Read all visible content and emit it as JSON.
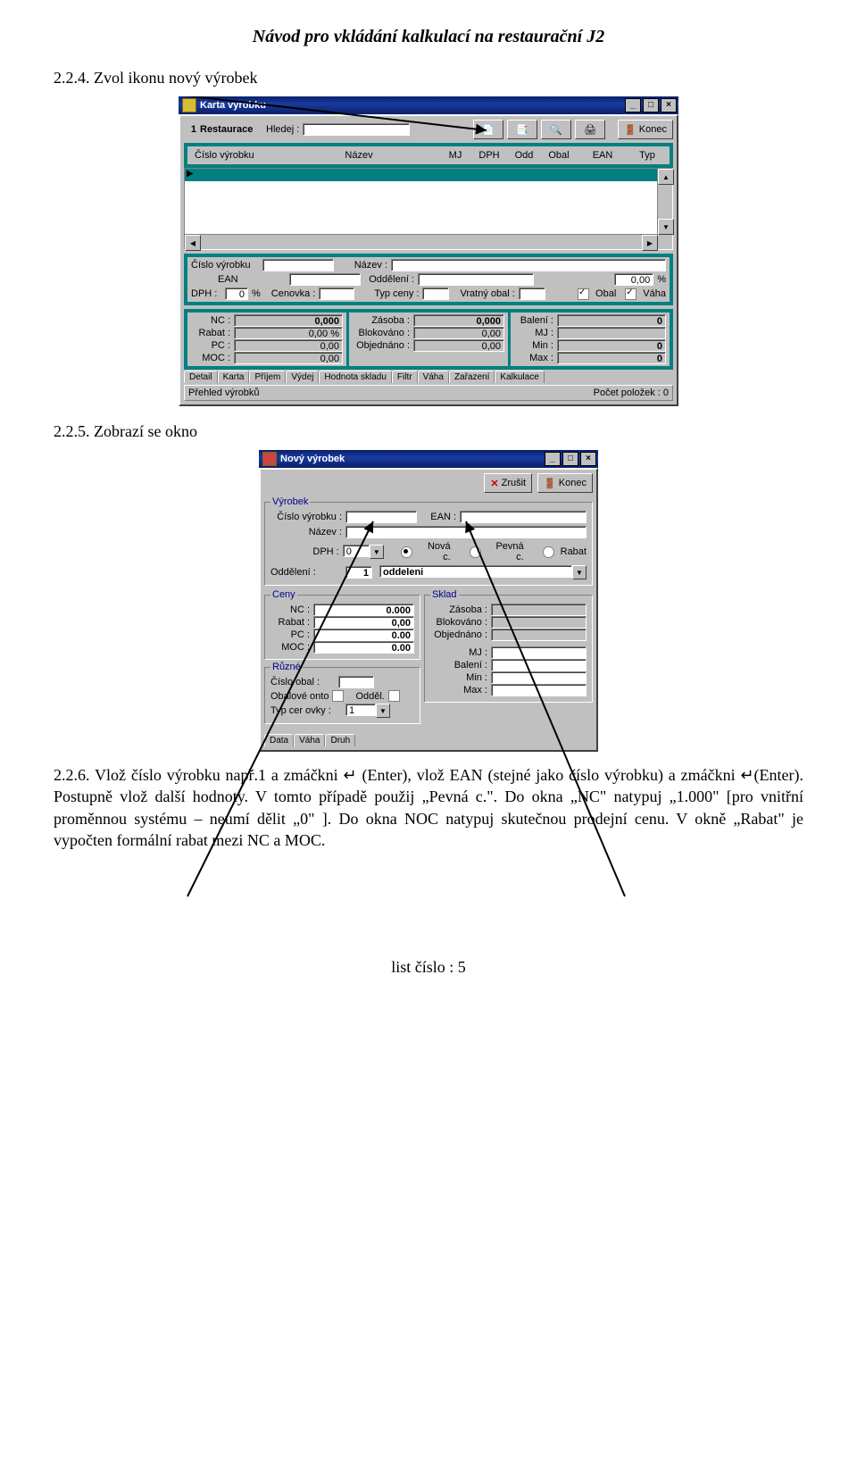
{
  "doc": {
    "title": "Návod pro vkládání kalkulací na restaurační J2",
    "step224": "2.2.4. Zvol ikonu nový výrobek",
    "step225": "2.2.5. Zobrazí se okno",
    "para": "2.2.6. Vlož číslo výrobku např.1 a zmáčkni   ↵ (Enter), vlož EAN (stejné jako číslo výrobku) a zmáčkni  ↵(Enter). Postupně vlož další hodnoty. V tomto případě použij „Pevná c.\". Do okna „NC\" natypuj „1.000\" [pro vnitřní proměnnou systému – neumí dělit „0\" ]. Do okna NOC natypuj skutečnou prodejní cenu. V okně „Rabat\" je vypočten formální rabat mezi NC a MOC.",
    "footer": "list číslo :  5"
  },
  "winA": {
    "title": "Karta výrobku",
    "id_label": "1",
    "restaurant": "Restaurace",
    "search_label": "Hledej :",
    "konec": "Konec",
    "cols": {
      "cislo": "Číslo výrobku",
      "nazev": "Název",
      "mj": "MJ",
      "dph": "DPH",
      "odd": "Odd",
      "obal": "Obal",
      "ean": "EAN",
      "typ": "Typ"
    },
    "f": {
      "cislo_vyrobku": "Číslo výrobku",
      "nazev": "Název :",
      "ean": "EAN",
      "oddeleni": "Oddělení :",
      "dph": "DPH :",
      "dph_val": "0",
      "dph_pct": "%",
      "cenovka": "Cenovka :",
      "typceny": "Typ ceny :",
      "vratny": "Vratný obal :",
      "obal_chk": "Obal",
      "vaha_chk": "Váha",
      "pct000": "0,00",
      "pctlbl": "%"
    },
    "g1": {
      "nc": "NC :",
      "rabat": "Rabat :",
      "pc": "PC :",
      "moc": "MOC :",
      "v1": "0,000",
      "v2": "0,00 %",
      "v3": "0,00",
      "v4": "0,00"
    },
    "g2": {
      "zasoba": "Zásoba :",
      "blok": "Blokováno :",
      "obj": "Objednáno :",
      "v1": "0,000",
      "v2": "0,00",
      "v3": "0,00"
    },
    "g3": {
      "baleni": "Balení :",
      "mj": "MJ :",
      "min": "Min :",
      "max": "Max :",
      "v1": "0",
      "v2": "",
      "v3": "0",
      "v4": "0"
    },
    "tabs": [
      "Detail",
      "Karta",
      "Příjem",
      "Výdej",
      "Hodnota skladu",
      "Filtr",
      "Váha",
      "Zařazení",
      "Kalkulace"
    ],
    "status_left": "Přehled výrobků",
    "status_right": "Počet položek : 0"
  },
  "winB": {
    "title": "Nový výrobek",
    "zrusit": "Zrušit",
    "konec": "Konec",
    "grp_vyrobek": "Výrobek",
    "cislo": "Číslo výrobku :",
    "ean": "EAN :",
    "nazev": "Název :",
    "dph": "DPH :",
    "dph_val": "0",
    "r_nova": "Nová c.",
    "r_pevna": "Pevná c.",
    "r_rabat": "Rabat",
    "oddeleni_lbl": "Oddělení :",
    "oddeleni_id": "1",
    "oddeleni_txt": "oddeleni",
    "grp_ceny": "Ceny",
    "ceny": {
      "nc": "NC :",
      "rabat": "Rabat :",
      "pc": "PC :",
      "moc": "MOC :",
      "v1": "0.000",
      "v2": "0,00",
      "v3": "0.00",
      "v4": "0.00"
    },
    "grp_sklad": "Sklad",
    "sklad": {
      "zasoba": "Zásoba :",
      "blok": "Blokováno :",
      "obj": "Objednáno :",
      "mj": "MJ :",
      "baleni": "Balení :",
      "min": "Min :",
      "max": "Max :"
    },
    "grp_ruzne": "Různé",
    "cislo_obal": "Číslo obal    :",
    "obalove_onto": "Obalové   onto",
    "oddel": "Odděl.",
    "typ_cerovky": "Typ cer ovky  :",
    "typ_cerovky_val": "1",
    "tabs": [
      "Data",
      "Váha",
      "Druh"
    ]
  }
}
